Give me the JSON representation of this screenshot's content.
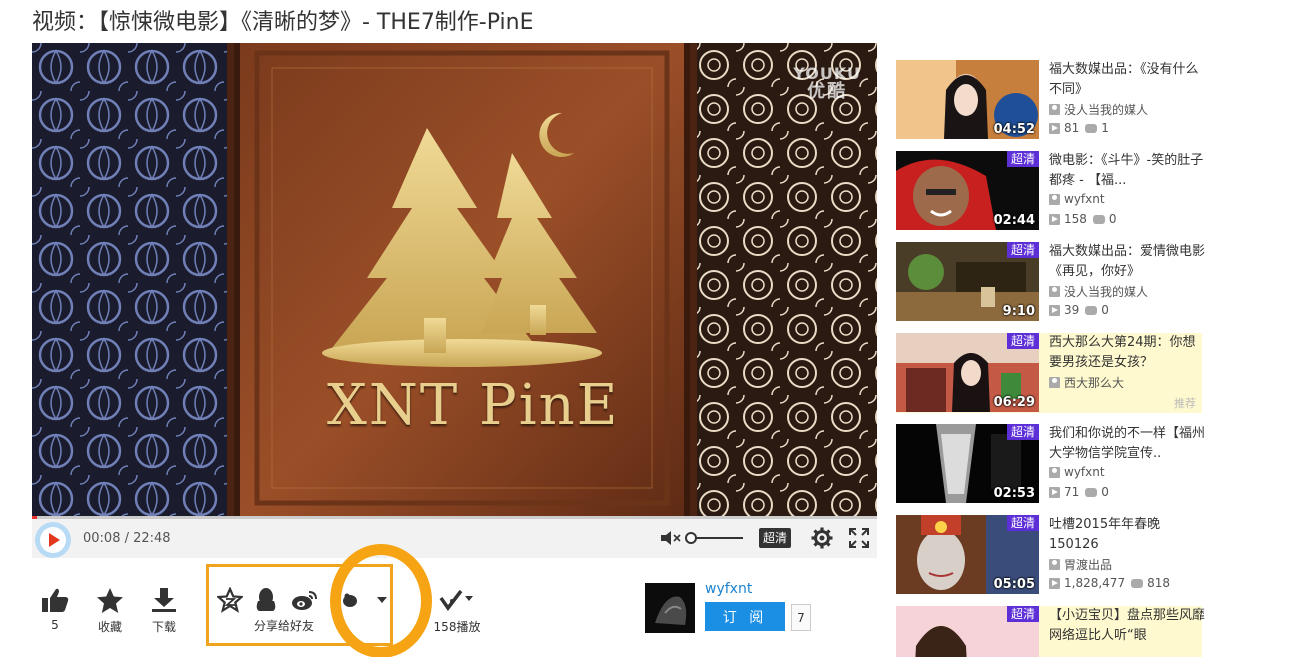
{
  "page": {
    "title": "视频：【惊悚微电影】《清晰的梦》- THE7制作-PinE"
  },
  "player": {
    "watermark_top": "YOUKU",
    "watermark_bottom": "优酷",
    "brand_text": "XNT PinE",
    "current_time": "00:08",
    "duration": "22:48",
    "time_display": "00:08 / 22:48",
    "progress_fraction": 0.006,
    "volume_fraction": 0.0,
    "quality_label": "超清"
  },
  "actions": {
    "like_count": "5",
    "favorite_label": "收藏",
    "download_label": "下载",
    "share_label": "分享给好友",
    "plays_label": "158播放"
  },
  "uploader": {
    "name": "wyfxnt",
    "subscribe_label": "订 阅",
    "subscriber_count": "7"
  },
  "sidebar": {
    "items": [
      {
        "title": "福大数媒出品：《没有什么不同》",
        "author": "没人当我的媒人",
        "plays": "81",
        "comments": "1",
        "duration": "04:52",
        "hd": "",
        "promo": "",
        "highlight": false
      },
      {
        "title": "微电影：《斗牛》-笑的肚子都疼 - 【福...",
        "author": "wyfxnt",
        "plays": "158",
        "comments": "0",
        "duration": "02:44",
        "hd": "超清",
        "promo": "",
        "highlight": false
      },
      {
        "title": "福大数媒出品：爱情微电影《再见，你好》",
        "author": "没人当我的媒人",
        "plays": "39",
        "comments": "0",
        "duration": "9:10",
        "hd": "超清",
        "promo": "",
        "highlight": false
      },
      {
        "title": "西大那么大第24期：你想要男孩还是女孩？",
        "author": "西大那么大",
        "plays": "",
        "comments": "",
        "duration": "06:29",
        "hd": "超清",
        "promo": "推荐",
        "highlight": true
      },
      {
        "title": "我们和你说的不一样【福州大学物信学院宣传..",
        "author": "wyfxnt",
        "plays": "71",
        "comments": "0",
        "duration": "02:53",
        "hd": "超清",
        "promo": "",
        "highlight": false
      },
      {
        "title": "吐槽2015年年春晚 150126",
        "author": "胃渡出品",
        "plays": "1,828,477",
        "comments": "818",
        "duration": "05:05",
        "hd": "超清",
        "promo": "",
        "highlight": false
      },
      {
        "title": "【小迈宝贝】盘点那些风靡网络逗比人听“眼",
        "author": "",
        "plays": "",
        "comments": "",
        "duration": "",
        "hd": "超清",
        "promo": "",
        "highlight": true
      }
    ]
  },
  "colors": {
    "accent_blue": "#1b8fe3",
    "hd_badge": "#5c2fd7",
    "annotation_orange": "#f6a413",
    "progress_red": "#e33"
  }
}
